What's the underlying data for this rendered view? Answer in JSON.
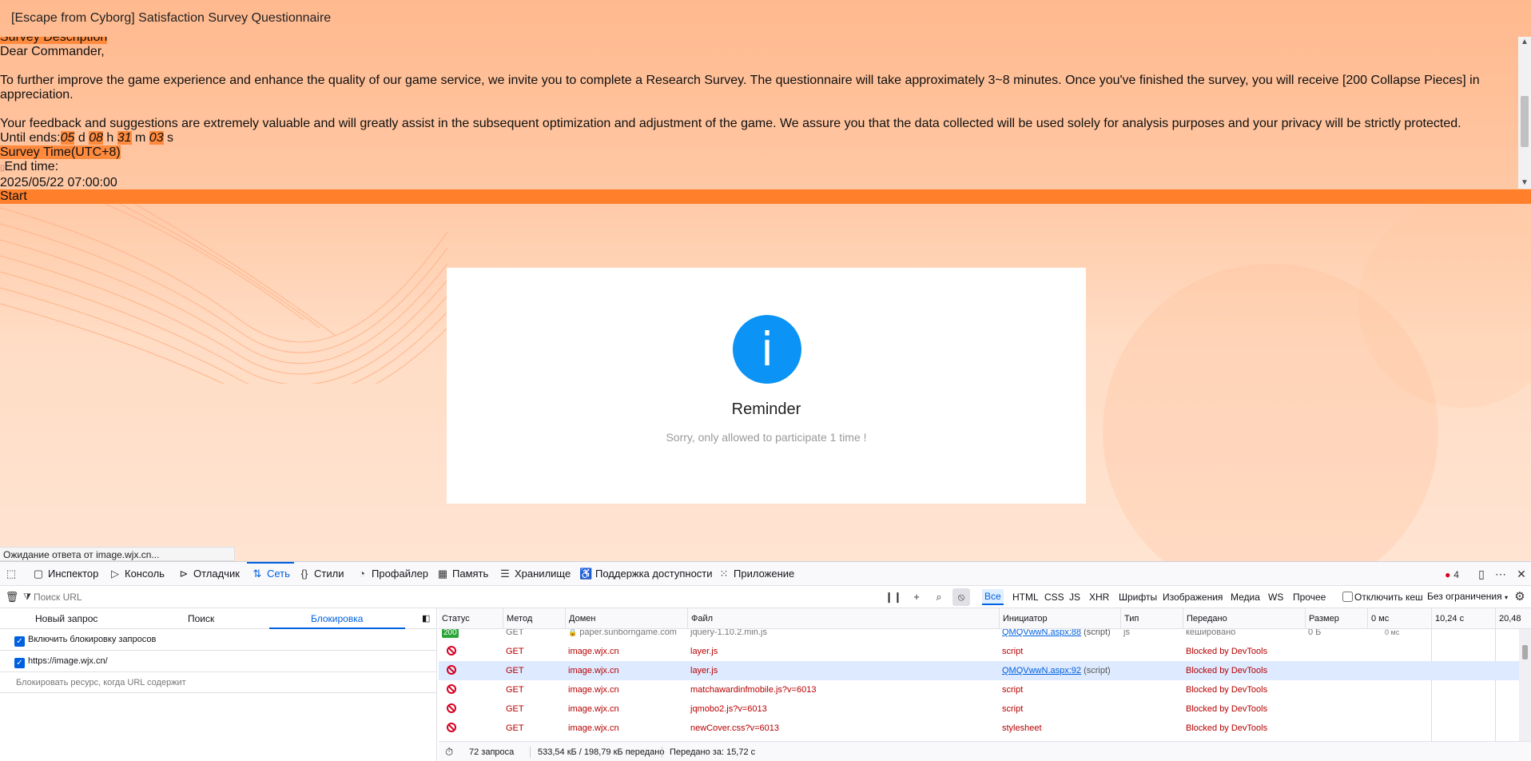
{
  "survey": {
    "title": "[Escape from Cyborg] Satisfaction Survey Questionnaire",
    "description_label": "Survey Description",
    "greeting": "Dear Commander,",
    "paragraph1": "To further improve the game experience and enhance the quality of our game service, we invite you to complete a Research Survey. The questionnaire will take approximately 3~8 minutes. Once you've finished the survey, you will receive [200 Collapse Pieces] in appreciation.",
    "paragraph2": "Your feedback and suggestions are extremely valuable and will greatly assist in the subsequent optimization and adjustment of the game. We assure you that the data collected will be used solely for analysis purposes and your privacy will be strictly protected.",
    "countdown": {
      "prefix": "Until ends:",
      "days": "05",
      "days_unit": " d ",
      "hours": "08",
      "hours_unit": " h ",
      "minutes": "31",
      "minutes_unit": " m ",
      "seconds": "03",
      "seconds_unit": " s"
    },
    "time_label": "Survey Time(UTC+8)",
    "end_time_label": "End time:",
    "end_time_value": "2025/05/22 07:00:00",
    "start_button": "Start"
  },
  "dialog": {
    "icon_char": "i",
    "title": "Reminder",
    "message": "Sorry, only allowed to participate 1 time !"
  },
  "status_bar": "Ожидание ответа от image.wjx.cn...",
  "devtools": {
    "tabs": [
      {
        "label": "Инспектор",
        "icon": "inspector-icon"
      },
      {
        "label": "Консоль",
        "icon": "console-icon"
      },
      {
        "label": "Отладчик",
        "icon": "debugger-icon"
      },
      {
        "label": "Сеть",
        "icon": "network-icon"
      },
      {
        "label": "Стили",
        "icon": "style-editor-icon"
      },
      {
        "label": "Профайлер",
        "icon": "profiler-icon"
      },
      {
        "label": "Память",
        "icon": "memory-icon"
      },
      {
        "label": "Хранилище",
        "icon": "storage-icon"
      },
      {
        "label": "Поддержка доступности",
        "icon": "accessibility-icon"
      },
      {
        "label": "Приложение",
        "icon": "application-icon"
      }
    ],
    "active_tab": "Сеть",
    "error_count": "4",
    "filter_placeholder": "Поиск URL",
    "type_filters": [
      "Все",
      "HTML",
      "CSS",
      "JS",
      "XHR",
      "Шрифты",
      "Изображения",
      "Медиа",
      "WS",
      "Прочее"
    ],
    "disable_cache_label": "Отключить кеш",
    "throttling": "Без ограничения",
    "sidebar": {
      "tabs": [
        "Новый запрос",
        "Поиск",
        "Блокировка"
      ],
      "enable_blocking_label": "Включить блокировку запросов",
      "blocked_url": "https://image.wjx.cn/",
      "input_placeholder": "Блокировать ресурс, когда URL содержит"
    },
    "columns": [
      "Статус",
      "Метод",
      "Домен",
      "Файл",
      "Инициатор",
      "Тип",
      "Передано",
      "Размер",
      "0 мс",
      "10,24 с",
      "20,48"
    ],
    "rows": [
      {
        "status": "200",
        "method": "GET",
        "domain": "paper.sunborngame.com",
        "file": "jquery-1.10.2.min.js",
        "initiator": "QMQVwwN.aspx:88",
        "initiator_suffix": " (script)",
        "type": "js",
        "transferred": "кешировано",
        "size": "0 Б",
        "waterfall": "0 мс"
      },
      {
        "status": "blocked",
        "method": "GET",
        "domain": "image.wjx.cn",
        "file": "layer.js",
        "initiator": "script",
        "initiator_suffix": "",
        "type": "",
        "transferred": "Blocked by DevTools",
        "size": ""
      },
      {
        "status": "blocked",
        "method": "GET",
        "domain": "image.wjx.cn",
        "file": "layer.js",
        "initiator": "QMQVwwN.aspx:92",
        "initiator_suffix": " (script)",
        "type": "",
        "transferred": "Blocked by DevTools",
        "size": ""
      },
      {
        "status": "blocked",
        "method": "GET",
        "domain": "image.wjx.cn",
        "file": "matchawardinfmobile.js?v=6013",
        "initiator": "script",
        "initiator_suffix": "",
        "type": "",
        "transferred": "Blocked by DevTools",
        "size": ""
      },
      {
        "status": "blocked",
        "method": "GET",
        "domain": "image.wjx.cn",
        "file": "jqmobo2.js?v=6013",
        "initiator": "script",
        "initiator_suffix": "",
        "type": "",
        "transferred": "Blocked by DevTools",
        "size": ""
      },
      {
        "status": "blocked",
        "method": "GET",
        "domain": "image.wjx.cn",
        "file": "newCover.css?v=6013",
        "initiator": "stylesheet",
        "initiator_suffix": "",
        "type": "",
        "transferred": "Blocked by DevTools",
        "size": ""
      }
    ],
    "summary": {
      "requests": "72 запроса",
      "transferred": "533,54 кБ / 198,79 кБ передано",
      "finish": "Передано за: 15,72 с"
    }
  },
  "colors": {
    "accent_orange": "#ff7f2a",
    "highlight_orange": "#ff8a3d",
    "info_blue": "#0b93f5",
    "devtools_blue": "#0061e0",
    "blocked_red": "#b80000"
  }
}
